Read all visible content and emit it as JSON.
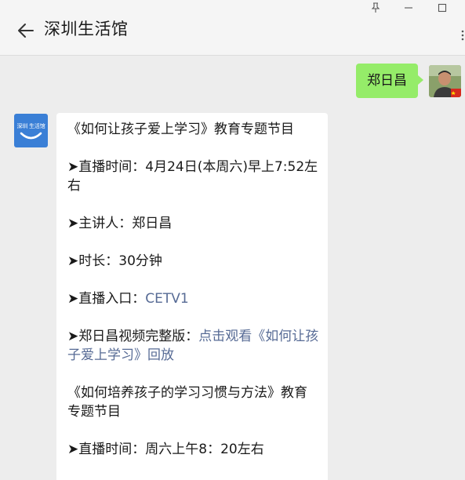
{
  "header": {
    "title": "深圳生活馆"
  },
  "outgoing": {
    "text": "郑日昌"
  },
  "incoming": {
    "avatar_text": "深圳 生活馆",
    "lines": {
      "program1_title": "《如何让孩子爱上学习》教育专题节目",
      "broadcast_label": "➤直播时间：",
      "broadcast_value": "4月24日(本周六)早上7:52左右",
      "host_label": "➤主讲人：",
      "host_value": "郑日昌",
      "duration_label": "➤时长：",
      "duration_value": "30分钟",
      "entry_label": "➤直播入口：",
      "entry_link": "CETV1",
      "replay_label": "➤郑日昌视频完整版：",
      "replay_link": "点击观看《如何让孩子爱上学习》回放",
      "program2_title": "《如何培养孩子的学习习惯与方法》教育专题节目",
      "broadcast2_label": "➤直播时间：",
      "broadcast2_value": "周六上午8：20左右"
    }
  },
  "colors": {
    "header_bg": "#f5f5f5",
    "chat_bg": "#ededed",
    "outgoing_bubble": "#95ec69",
    "incoming_bubble": "#ffffff",
    "link": "#576b95",
    "avatar_blue": "#3a7fd6"
  },
  "icons": {
    "back": "arrow-left-icon",
    "pin": "pin-icon",
    "minimize": "minimize-icon",
    "maximize": "maximize-icon",
    "more": "more-dots-icon"
  }
}
